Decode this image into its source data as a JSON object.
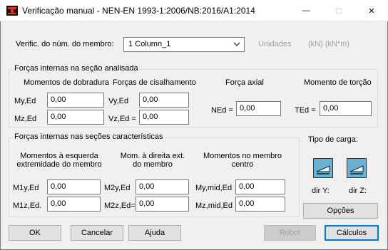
{
  "window": {
    "title": "Verificação manual - NEN-EN 1993-1:2006/NB:2016/A1:2014",
    "controls": {
      "minimize": "—",
      "maximize": "☐",
      "close": "✕"
    }
  },
  "member": {
    "label": "Verific. do núm. do membro:",
    "selected": "1 Column_1",
    "units_label": "Unidades",
    "units_value": "(kN) (kN*m)"
  },
  "section_forces": {
    "group_title": "Forças internas na seção analisada",
    "bending_title": "Momentos de dobradura",
    "shear_title": "Forças de cisalhamento",
    "axial_title": "Força axial",
    "torsion_title": "Momento de torção",
    "my_label": "My,Ed",
    "my_value": "0,00",
    "mz_label": "Mz,Ed",
    "mz_value": "0,00",
    "vy_label": "Vy,Ed",
    "vy_value": "0,00",
    "vz_label": "Vz,Ed =",
    "vz_value": "0,00",
    "ned_label": "NEd =",
    "ned_value": "0,00",
    "ted_label": "TEd =",
    "ted_value": "0,00"
  },
  "characteristic": {
    "group_title": "Forças internas nas seções características",
    "left_title": "Momentos à esquerda extremidade do membro",
    "right_title": "Mom. à direita ext. do membro",
    "center_title": "Momentos no membro centro",
    "m1y_label": "M1y,Ed",
    "m1y_value": "0,00",
    "m1z_label": "M1z,Ed.",
    "m1z_value": "0,00",
    "m2y_label": "M2y,Ed",
    "m2y_value": "0,00",
    "m2z_label": "M2z,Ed=",
    "m2z_value": "0,00",
    "mymid_label": "My,mid,Ed",
    "mymid_value": "0,00",
    "mzmid_label": "Mz,mid,Ed",
    "mzmid_value": "0,00"
  },
  "load_type": {
    "title": "Tipo de carga:",
    "dir_y": "dir Y:",
    "dir_z": "dir Z:"
  },
  "buttons": {
    "options": "Opções",
    "ok": "OK",
    "cancel": "Cancelar",
    "help": "Ajuda",
    "robot": "Robot",
    "calculations": "Cálculos"
  }
}
